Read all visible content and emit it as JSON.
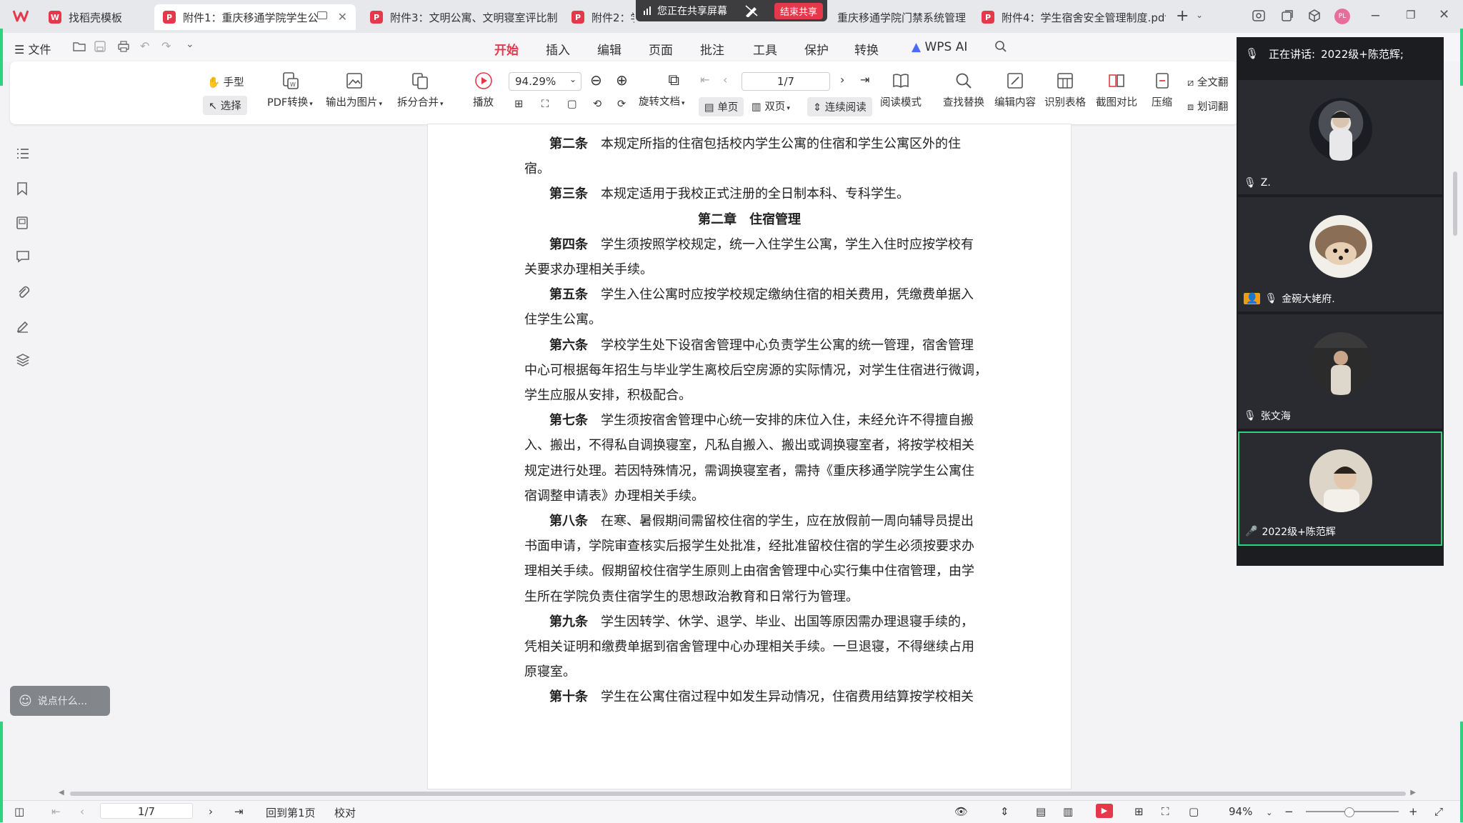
{
  "colors": {
    "accent": "#e5394b",
    "share_green": "#2fd27e"
  },
  "tabs": [
    {
      "label": "找稻壳模板"
    },
    {
      "label": "附件1：重庆移通学院学生公"
    },
    {
      "label": "附件3：文明公寓、文明寝室评比制"
    },
    {
      "label": "附件2：学"
    },
    {
      "label": "重庆移通学院门禁系统管理"
    },
    {
      "label": "附件4：学生宿舍安全管理制度.pdf"
    }
  ],
  "sharebar": {
    "text": "您正在共享屏幕",
    "end": "结束共享"
  },
  "user_badge": "PL",
  "menu": {
    "file": "文件",
    "items": [
      "开始",
      "插入",
      "编辑",
      "页面",
      "批注",
      "工具",
      "保护",
      "转换",
      "WPS AI"
    ]
  },
  "toolbar": {
    "hand": "手型",
    "select": "选择",
    "pdf_convert": "PDF转换",
    "export_image": "输出为图片",
    "split_merge": "拆分合并",
    "play": "播放",
    "zoom": "94.29%",
    "rotate": "旋转文档",
    "single": "单页",
    "double": "双页",
    "continuous": "连续阅读",
    "page": "1/7",
    "read_mode": "阅读模式",
    "find_replace": "查找替换",
    "edit_content": "编辑内容",
    "recognize_table": "识别表格",
    "screenshot_compare": "截图对比",
    "compress": "压缩",
    "fulltext": "全文翻",
    "word_translate": "划词翻"
  },
  "document": {
    "lines": [
      {
        "k": "第二条",
        "t": "本规定所指的住宿包括校内学生公寓的住宿和学生公寓区外的住"
      },
      {
        "k": "",
        "t": "宿。"
      },
      {
        "k": "第三条",
        "t": "本规定适用于我校正式注册的全日制本科、专科学生。"
      },
      {
        "h": "第二章　住宿管理"
      },
      {
        "k": "第四条",
        "t": "学生须按照学校规定，统一入住学生公寓，学生入住时应按学校有"
      },
      {
        "k": "",
        "t": "关要求办理相关手续。"
      },
      {
        "k": "第五条",
        "t": "学生入住公寓时应按学校规定缴纳住宿的相关费用，凭缴费单据入"
      },
      {
        "k": "",
        "t": "住学生公寓。"
      },
      {
        "k": "第六条",
        "t": "学校学生处下设宿舍管理中心负责学生公寓的统一管理，宿舍管理"
      },
      {
        "k": "",
        "t": "中心可根据每年招生与毕业学生离校后空房源的实际情况，对学生住宿进行微调，"
      },
      {
        "k": "",
        "t": "学生应服从安排，积极配合。"
      },
      {
        "k": "第七条",
        "t": "学生须按宿舍管理中心统一安排的床位入住，未经允许不得擅自搬"
      },
      {
        "k": "",
        "t": "入、搬出，不得私自调换寝室，凡私自搬入、搬出或调换寝室者，将按学校相关"
      },
      {
        "k": "",
        "t": "规定进行处理。若因特殊情况，需调换寝室者，需持《重庆移通学院学生公寓住"
      },
      {
        "k": "",
        "t": "宿调整申请表》办理相关手续。"
      },
      {
        "k": "第八条",
        "t": "在寒、暑假期间需留校住宿的学生，应在放假前一周向辅导员提出"
      },
      {
        "k": "",
        "t": "书面申请，学院审查核实后报学生处批准，经批准留校住宿的学生必须按要求办"
      },
      {
        "k": "",
        "t": "理相关手续。假期留校住宿学生原则上由宿舍管理中心实行集中住宿管理，由学"
      },
      {
        "k": "",
        "t": "生所在学院负责住宿学生的思想政治教育和日常行为管理。"
      },
      {
        "k": "第九条",
        "t": "学生因转学、休学、退学、毕业、出国等原因需办理退寝手续的，"
      },
      {
        "k": "",
        "t": "凭相关证明和缴费单据到宿舍管理中心办理相关手续。一旦退寝，不得继续占用"
      },
      {
        "k": "",
        "t": "原寝室。"
      },
      {
        "k": "第十条",
        "t": "学生在公寓住宿过程中如发生异动情况，住宿费用结算按学校相关"
      }
    ]
  },
  "chat": {
    "placeholder": "说点什么..."
  },
  "statusbar": {
    "page": "1/7",
    "back_first": "回到第1页",
    "proofread": "校对",
    "zoom": "94%"
  },
  "meeting": {
    "speaking_label": "正在讲话:",
    "speaking_name": "2022级+陈范辉;",
    "participants": [
      {
        "name": "Z."
      },
      {
        "name": "金碗大姥府."
      },
      {
        "name": "张文海"
      },
      {
        "name": "2022级+陈范辉"
      }
    ]
  }
}
